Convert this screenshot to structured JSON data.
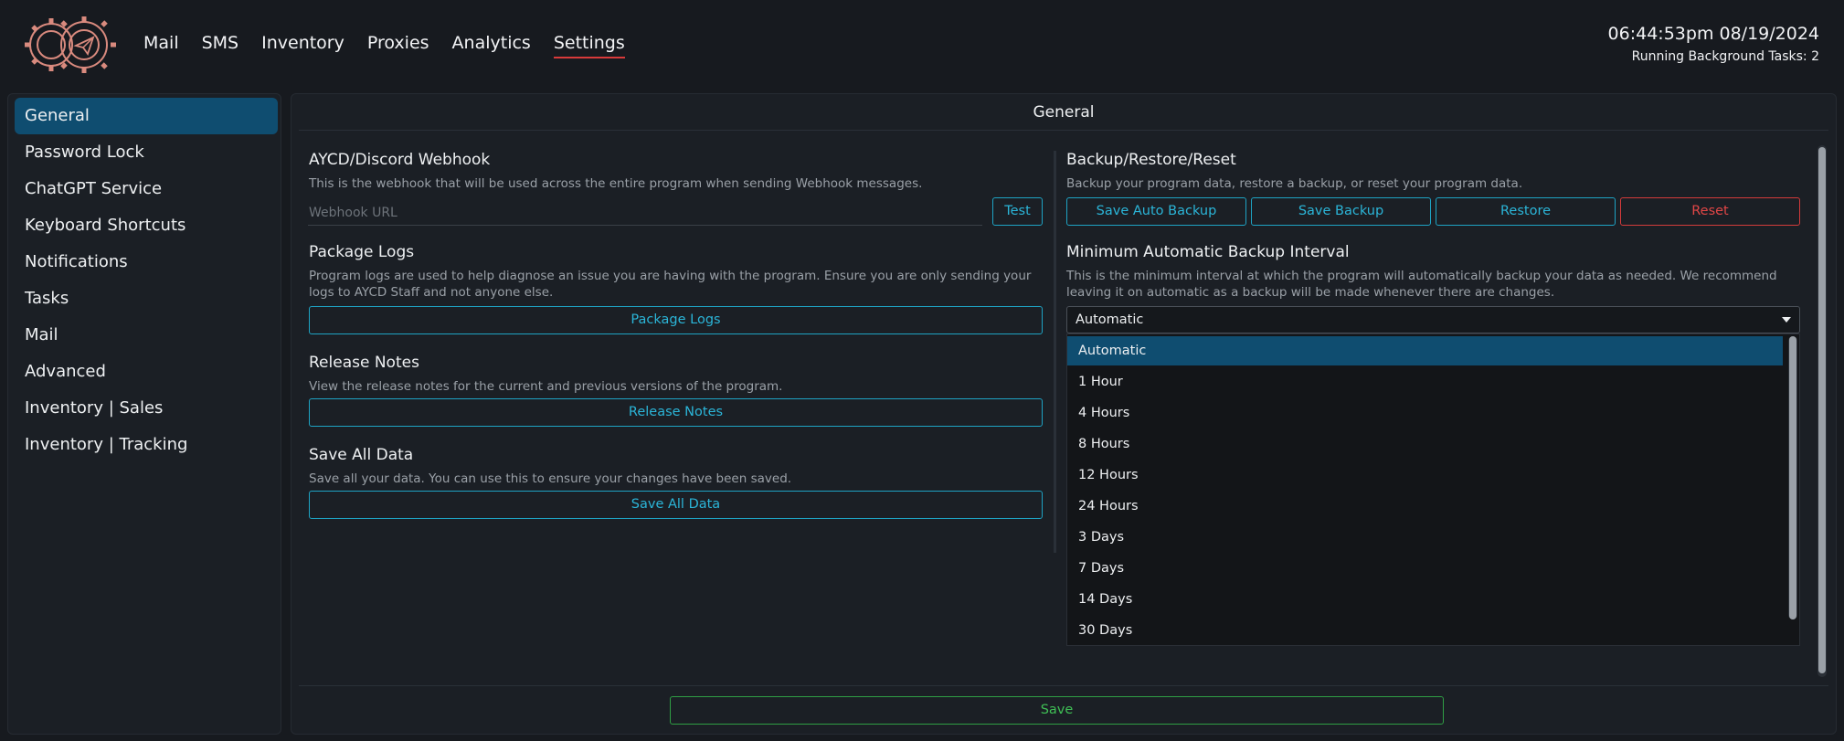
{
  "nav": {
    "items": [
      {
        "label": "Mail"
      },
      {
        "label": "SMS"
      },
      {
        "label": "Inventory"
      },
      {
        "label": "Proxies"
      },
      {
        "label": "Analytics"
      },
      {
        "label": "Settings",
        "active": true
      }
    ]
  },
  "status": {
    "time": "06:44:53pm 08/19/2024",
    "tasks": "Running Background Tasks: 2"
  },
  "sidebar": {
    "items": [
      {
        "label": "General",
        "active": true
      },
      {
        "label": "Password Lock"
      },
      {
        "label": "ChatGPT Service"
      },
      {
        "label": "Keyboard Shortcuts"
      },
      {
        "label": "Notifications"
      },
      {
        "label": "Tasks"
      },
      {
        "label": "Mail"
      },
      {
        "label": "Advanced"
      },
      {
        "label": "Inventory | Sales"
      },
      {
        "label": "Inventory | Tracking"
      }
    ]
  },
  "main": {
    "title": "General",
    "webhook": {
      "title": "AYCD/Discord Webhook",
      "desc": "This is the webhook that will be used across the entire program when sending Webhook messages.",
      "placeholder": "Webhook URL",
      "value": "",
      "test_label": "Test"
    },
    "package_logs": {
      "title": "Package Logs",
      "desc": "Program logs are used to help diagnose an issue you are having with the program. Ensure you are only sending your logs to AYCD Staff and not anyone else.",
      "button": "Package Logs"
    },
    "release_notes": {
      "title": "Release Notes",
      "desc": "View the release notes for the current and previous versions of the program.",
      "button": "Release Notes"
    },
    "save_all": {
      "title": "Save All Data",
      "desc": "Save all your data. You can use this to ensure your changes have been saved.",
      "button": "Save All Data"
    },
    "backup": {
      "title": "Backup/Restore/Reset",
      "desc": "Backup your program data, restore a backup, or reset your program data.",
      "save_auto": "Save Auto Backup",
      "save": "Save Backup",
      "restore": "Restore",
      "reset": "Reset"
    },
    "interval": {
      "title": "Minimum Automatic Backup Interval",
      "desc": "This is the minimum interval at which the program will automatically backup your data as needed. We recommend leaving it on automatic as a backup will be made whenever there are changes.",
      "selected": "Automatic",
      "options": [
        "Automatic",
        "1 Hour",
        "4 Hours",
        "8 Hours",
        "12 Hours",
        "24 Hours",
        "3 Days",
        "7 Days",
        "14 Days",
        "30 Days"
      ]
    },
    "save_label": "Save"
  },
  "colors": {
    "accent_blue": "#1ea3c4",
    "selected_bg": "#0f4d70",
    "danger": "#d33b3b",
    "success": "#2f9e44",
    "nav_underline": "#d83a3a"
  },
  "icons": {
    "logo": "gear-logo-icon",
    "select_caret": "caret-down-icon"
  }
}
